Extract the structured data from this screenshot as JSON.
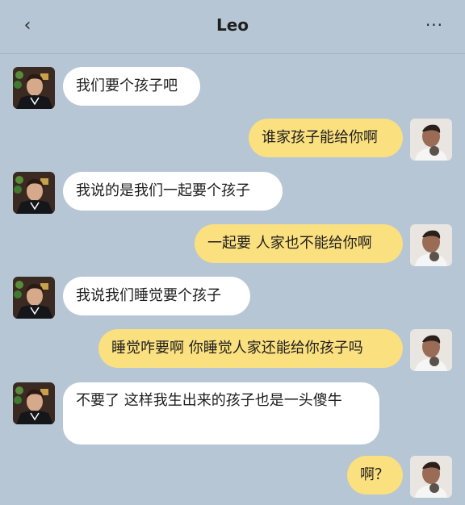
{
  "header": {
    "back_icon": "chevron-left-icon",
    "title": "Leo",
    "more_icon": "more-horizontal-icon"
  },
  "colors": {
    "background": "#b7c6d4",
    "incoming_bubble": "#ffffff",
    "outgoing_bubble": "#fbe07f"
  },
  "messages": [
    {
      "side": "left",
      "avatar": "contact-avatar",
      "text": "我们要个孩子吧"
    },
    {
      "side": "right",
      "avatar": "self-avatar",
      "text": "谁家孩子能给你啊"
    },
    {
      "side": "left",
      "avatar": "contact-avatar",
      "text": "我说的是我们一起要个孩子"
    },
    {
      "side": "right",
      "avatar": "self-avatar",
      "text": "一起要 人家也不能给你啊"
    },
    {
      "side": "left",
      "avatar": "contact-avatar",
      "text": "我说我们睡觉要个孩子"
    },
    {
      "side": "right",
      "avatar": "self-avatar",
      "text": "睡觉咋要啊 你睡觉人家还能给你孩子吗"
    },
    {
      "side": "left",
      "avatar": "contact-avatar",
      "text": "不要了 这样我生出来的孩子也是一头傻牛"
    },
    {
      "side": "right",
      "avatar": "self-avatar",
      "text": "啊？"
    }
  ]
}
